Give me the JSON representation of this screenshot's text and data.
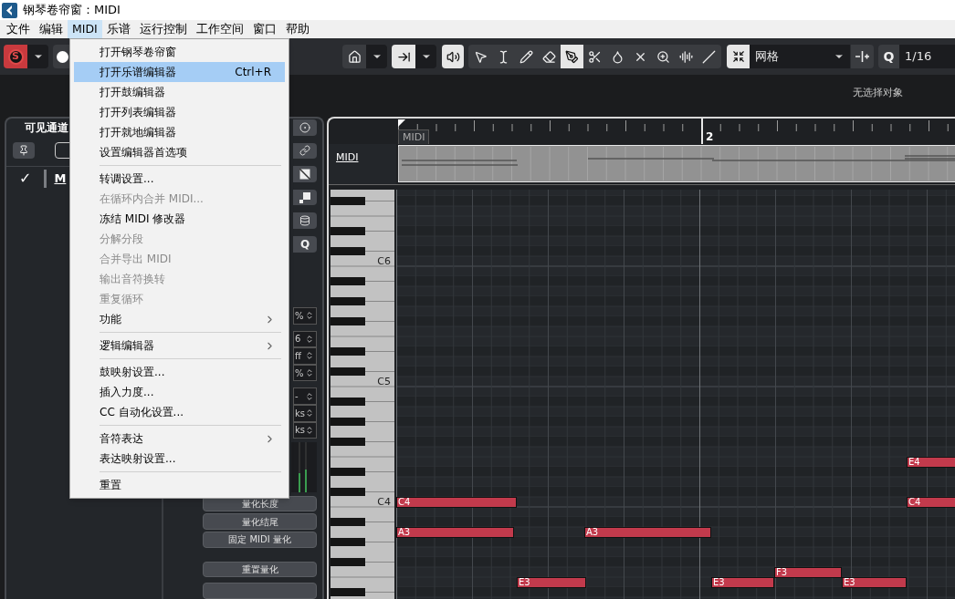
{
  "window": {
    "title": "钢琴卷帘窗：MIDI"
  },
  "menubar": [
    {
      "label": "文件",
      "selected": false
    },
    {
      "label": "编辑",
      "selected": false
    },
    {
      "label": "MIDI",
      "selected": true
    },
    {
      "label": "乐谱",
      "selected": false
    },
    {
      "label": "运行控制",
      "selected": false
    },
    {
      "label": "工作空间",
      "selected": false
    },
    {
      "label": "窗口",
      "selected": false
    },
    {
      "label": "帮助",
      "selected": false
    }
  ],
  "toolbar": {
    "mode_button": "S",
    "tools": [
      {
        "kind": "arrow",
        "selected": false
      },
      {
        "kind": "range",
        "selected": false
      },
      {
        "kind": "pencil",
        "selected": false
      },
      {
        "kind": "eraser",
        "selected": false
      },
      {
        "kind": "knife",
        "selected": true
      },
      {
        "kind": "scissors",
        "selected": false
      },
      {
        "kind": "glue",
        "selected": false
      },
      {
        "kind": "mute",
        "selected": false
      },
      {
        "kind": "zoom",
        "selected": false
      },
      {
        "kind": "comb",
        "selected": false
      },
      {
        "kind": "line",
        "selected": false
      }
    ],
    "grid_type": "网格",
    "quantize_label": "Q",
    "quantize": "1/16"
  },
  "info_line": "无选择对象",
  "inspector": {
    "tab": "可见通道",
    "track_check": "✓",
    "track_name": "M",
    "icon_label": "Q",
    "fields": [
      "%",
      "6",
      "ff",
      "%",
      "-",
      "ks",
      "ks"
    ],
    "buttons": [
      "量化长度",
      "量化结尾",
      "固定 MIDI 量化",
      "重置量化"
    ]
  },
  "editor": {
    "bar_number": "2",
    "part_tab": "MIDI",
    "lane_label": "MIDI",
    "key_labels": [
      "C6",
      "C5",
      "C4"
    ],
    "notes": [
      {
        "label": "E4"
      },
      {
        "label": "C4"
      },
      {
        "label": "C4"
      },
      {
        "label": "A3"
      },
      {
        "label": "A3"
      },
      {
        "label": "F3"
      },
      {
        "label": "E3"
      },
      {
        "label": "E3"
      },
      {
        "label": "E3"
      }
    ]
  },
  "menu": {
    "items": [
      {
        "kind": "item",
        "label": "打开钢琴卷帘窗",
        "disabled": false,
        "selected": false
      },
      {
        "kind": "item",
        "label": "打开乐谱编辑器",
        "shortcut": "Ctrl+R",
        "disabled": false,
        "selected": true
      },
      {
        "kind": "item",
        "label": "打开鼓编辑器",
        "disabled": false,
        "selected": false
      },
      {
        "kind": "item",
        "label": "打开列表编辑器",
        "disabled": false,
        "selected": false
      },
      {
        "kind": "item",
        "label": "打开就地编辑器",
        "disabled": false,
        "selected": false
      },
      {
        "kind": "item",
        "label": "设置编辑器首选项",
        "disabled": false,
        "selected": false
      },
      {
        "kind": "separator"
      },
      {
        "kind": "item",
        "label": "转调设置...",
        "disabled": false,
        "selected": false
      },
      {
        "kind": "item",
        "label": "在循环内合并 MIDI...",
        "disabled": true,
        "selected": false
      },
      {
        "kind": "item",
        "label": "冻结 MIDI 修改器",
        "disabled": false,
        "selected": false
      },
      {
        "kind": "item",
        "label": "分解分段",
        "disabled": true,
        "selected": false
      },
      {
        "kind": "item",
        "label": "合并导出 MIDI",
        "disabled": true,
        "selected": false
      },
      {
        "kind": "item",
        "label": "输出音符换转",
        "disabled": true,
        "selected": false
      },
      {
        "kind": "item",
        "label": "重复循环",
        "disabled": true,
        "selected": false
      },
      {
        "kind": "submenu",
        "label": "功能",
        "disabled": false,
        "selected": false
      },
      {
        "kind": "separator"
      },
      {
        "kind": "submenu",
        "label": "逻辑编辑器",
        "disabled": false,
        "selected": false
      },
      {
        "kind": "separator"
      },
      {
        "kind": "item",
        "label": "鼓映射设置...",
        "disabled": false,
        "selected": false
      },
      {
        "kind": "item",
        "label": "插入力度...",
        "disabled": false,
        "selected": false
      },
      {
        "kind": "item",
        "label": "CC 自动化设置...",
        "disabled": false,
        "selected": false
      },
      {
        "kind": "separator"
      },
      {
        "kind": "submenu",
        "label": "音符表达",
        "disabled": false,
        "selected": false
      },
      {
        "kind": "item",
        "label": "表达映射设置...",
        "disabled": false,
        "selected": false
      },
      {
        "kind": "separator"
      },
      {
        "kind": "item",
        "label": "重置",
        "disabled": false,
        "selected": false
      }
    ]
  }
}
